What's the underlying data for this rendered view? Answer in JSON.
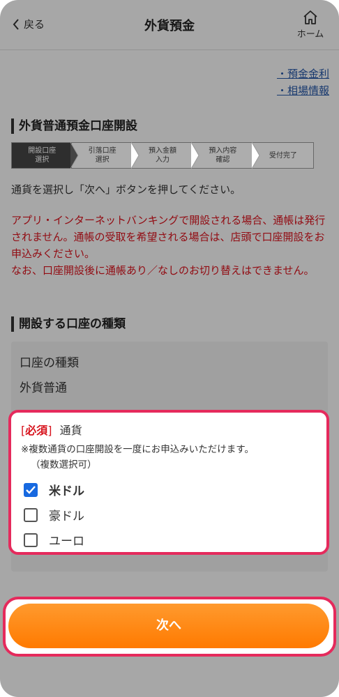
{
  "header": {
    "back_label": "戻る",
    "title": "外貨預金",
    "home_label": "ホーム"
  },
  "links": [
    {
      "label": "・預金金利"
    },
    {
      "label": "・相場情報"
    }
  ],
  "section1_title": "外貨普通預金口座開設",
  "steps": [
    {
      "line1": "開設口座",
      "line2": "選択",
      "active": true
    },
    {
      "line1": "引落口座",
      "line2": "選択",
      "active": false
    },
    {
      "line1": "預入金額",
      "line2": "入力",
      "active": false
    },
    {
      "line1": "預入内容",
      "line2": "確認",
      "active": false
    },
    {
      "line1": "受付完了",
      "line2": "",
      "active": false
    }
  ],
  "instruction": "通貨を選択し「次へ」ボタンを押してください。",
  "warning": "アプリ・インターネットバンキングで開設される場合、通帳は発行されません。通帳の受取を希望される場合は、店頭で口座開設をお申込みください。\nなお、口座開設後に通帳あり／なしのお切り替えはできません。",
  "section2_title": "開設する口座の種類",
  "account_type": {
    "label": "口座の種類",
    "value": "外貨普通"
  },
  "currency": {
    "required_bracket_open": "[",
    "required_label": "必須",
    "required_bracket_close": "]",
    "field_label": "通貨",
    "note_line1": "※複数通貨の口座開設を一度にお申込みいただけます。",
    "note_line2": "（複数選択可）",
    "options": [
      {
        "label": "米ドル",
        "checked": true
      },
      {
        "label": "豪ドル",
        "checked": false
      },
      {
        "label": "ユーロ",
        "checked": false
      }
    ]
  },
  "next_button": "次へ",
  "colors": {
    "highlight": "#e52a5c",
    "accent_orange": "#ff7a00",
    "warning_red": "#d7131d",
    "link_blue": "#2455a4",
    "checkbox_blue": "#1769e0"
  }
}
